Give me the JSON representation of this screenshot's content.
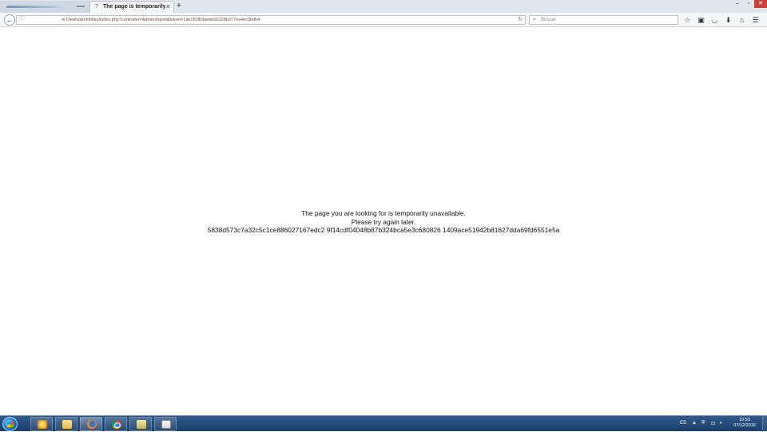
{
  "browser": {
    "tabs": [
      {
        "title": "",
        "active": false
      },
      {
        "title": "The page is temporarily un...",
        "favicon": "?",
        "active": true
      }
    ],
    "new_tab_icon": "+",
    "window_controls": {
      "minimize": "–",
      "maximize": "▫",
      "close": "✕"
    },
    "address": "/eTdeehvdmhlhfisu/index.php?controller=AdminImport&token=1de1f03b9aebb00128b377ea4ec0bdb4",
    "search_placeholder": "Buscar",
    "toolbar_icons": [
      "star-icon",
      "clipboard-icon",
      "pocket-icon",
      "download-icon",
      "home-icon",
      "menu-icon"
    ]
  },
  "content": {
    "line1": "The page you are looking for is temporarily unavailable.",
    "line2": "Please try again later.",
    "line3": "5838d573c7a32c5c1ce886027167edc2 9f14cdf04048b87b324bca5e3c680826 1409ace51942b81627dda69fd6551e5a"
  },
  "taskbar": {
    "apps": [
      "internet-explorer",
      "file-explorer",
      "firefox",
      "chrome",
      "folder",
      "notepad"
    ],
    "language": "ES",
    "time": "10:53",
    "date": "07/12/2016"
  }
}
